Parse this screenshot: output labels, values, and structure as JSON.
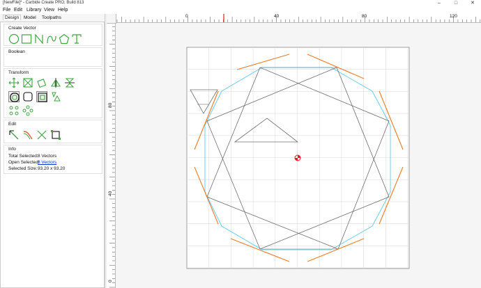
{
  "window": {
    "title": "[NewFile]* - Carbide Create PRO, Build 813",
    "minimize": "–",
    "maximize": "□",
    "close": "✕"
  },
  "menu": [
    {
      "label": "File"
    },
    {
      "label": "Edit"
    },
    {
      "label": "Library"
    },
    {
      "label": "View"
    },
    {
      "label": "Help"
    }
  ],
  "tabs": [
    "Design",
    "Model",
    "Toolpaths"
  ],
  "sections": {
    "create_vector": "Create Vector",
    "boolean": "Boolean",
    "transform": "Transform",
    "edit": "Edit",
    "info": "Info"
  },
  "info": {
    "total_selected_label": "Total Selected:",
    "total_selected_value": "8 Vectors",
    "open_selected_label": "Open Selected:",
    "open_selected_value": "8 Vectors",
    "selected_size_label": "Selected Size:",
    "selected_size_value": "93.20 x 93.20"
  },
  "ruler": {
    "x_labels": [
      "0",
      "40",
      "80",
      "120"
    ],
    "y_labels": [
      "80",
      "40",
      "0"
    ]
  },
  "icons": {
    "create": [
      "circle-icon",
      "rectangle-icon",
      "polyline-icon",
      "curve-icon",
      "polygon-icon",
      "text-icon"
    ],
    "transform": [
      "move-icon",
      "scale-icon",
      "rotate-icon",
      "mirror-icon",
      "flip-icon",
      "offset-icon",
      "round-rectangle-icon",
      "align-icon",
      "nest-icon",
      "grid-array-icon",
      "circular-array-icon"
    ],
    "edit": [
      "node-edit-icon",
      "join-icon",
      "trim-icon",
      "bounding-box-icon"
    ]
  },
  "colors": {
    "vector_gray": "#6e6e6e",
    "selected_orange": "#f07a20",
    "cyan": "#5ecbf0",
    "grid": "#dcdcdc",
    "origin_red": "#e02020",
    "icon_green": "#3fa53f"
  }
}
